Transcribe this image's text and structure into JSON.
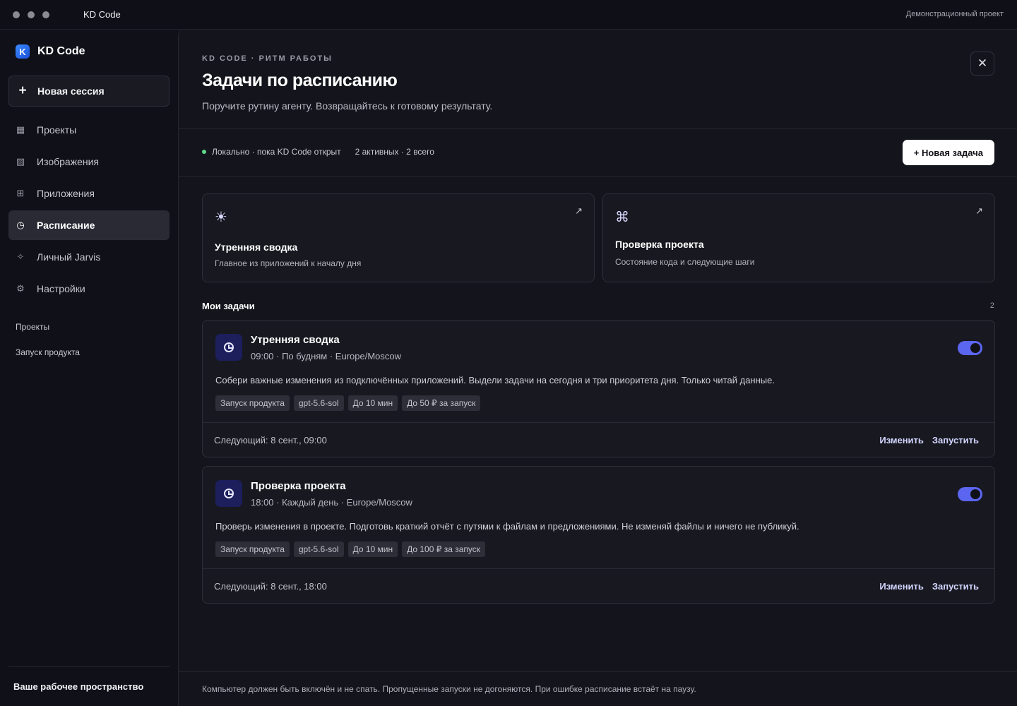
{
  "titlebar": {
    "app_title": "KD Code",
    "project_label": "Демонстрационный проект"
  },
  "sidebar": {
    "brand_logo": "K",
    "brand_name": "KD Code",
    "new_session_label": "Новая сессия",
    "items": [
      {
        "icon": "grid-icon",
        "glyph": "▦",
        "label": "Проекты"
      },
      {
        "icon": "image-icon",
        "glyph": "▧",
        "label": "Изображения"
      },
      {
        "icon": "apps-icon",
        "glyph": "⊞",
        "label": "Приложения"
      },
      {
        "icon": "clock-icon",
        "glyph": "◷",
        "label": "Расписание"
      },
      {
        "icon": "sparkle-icon",
        "glyph": "✧",
        "label": "Личный Jarvis"
      },
      {
        "icon": "gear-icon",
        "glyph": "⚙",
        "label": "Настройки"
      }
    ],
    "section_label": "Проекты",
    "project_item": "Запуск продукта",
    "workspace_label": "Ваше рабочее пространство"
  },
  "header": {
    "eyebrow": "KD CODE · РИТМ РАБОТЫ",
    "title": "Задачи по расписанию",
    "subtitle": "Поручите рутину агенту. Возвращайтесь к готовому результату."
  },
  "status": {
    "mode": "Локально · пока KD Code открыт",
    "counts": "2 активных · 2 всего",
    "new_task_label": "+ Новая задача"
  },
  "quick_cards": [
    {
      "icon": "sun-icon",
      "glyph": "☀",
      "title": "Утренняя сводка",
      "desc": "Главное из приложений к началу дня"
    },
    {
      "icon": "command-icon",
      "glyph": "⌘",
      "title": "Проверка проекта",
      "desc": "Состояние кода и следующие шаги"
    }
  ],
  "tasks_section": {
    "title": "Мои задачи",
    "count": "2"
  },
  "tasks": [
    {
      "title": "Утренняя сводка",
      "meta": "09:00 · По будням · Europe/Moscow",
      "enabled": true,
      "desc": "Собери важные изменения из подключённых приложений. Выдели задачи на сегодня и три приоритета дня. Только читай данные.",
      "tags": [
        "Запуск продукта",
        "gpt-5.6-sol",
        "До 10 мин",
        "До 50 ₽ за запуск"
      ],
      "next": "Следующий: 8 сент., 09:00",
      "edit_label": "Изменить",
      "run_label": "Запустить"
    },
    {
      "title": "Проверка проекта",
      "meta": "18:00 · Каждый день · Europe/Moscow",
      "enabled": true,
      "desc": "Проверь изменения в проекте. Подготовь краткий отчёт с путями к файлам и предложениями. Не изменяй файлы и ничего не публикуй.",
      "tags": [
        "Запуск продукта",
        "gpt-5.6-sol",
        "До 10 мин",
        "До 100 ₽ за запуск"
      ],
      "next": "Следующий: 8 сент., 18:00",
      "edit_label": "Изменить",
      "run_label": "Запустить"
    }
  ],
  "footer_note": "Компьютер должен быть включён и не спать. Пропущенные запуски не догоняются. При ошибке расписание встаёт на паузу.",
  "colors": {
    "accent": "#5b66f0",
    "status_dot": "#5ed98a",
    "background": "#101019"
  }
}
